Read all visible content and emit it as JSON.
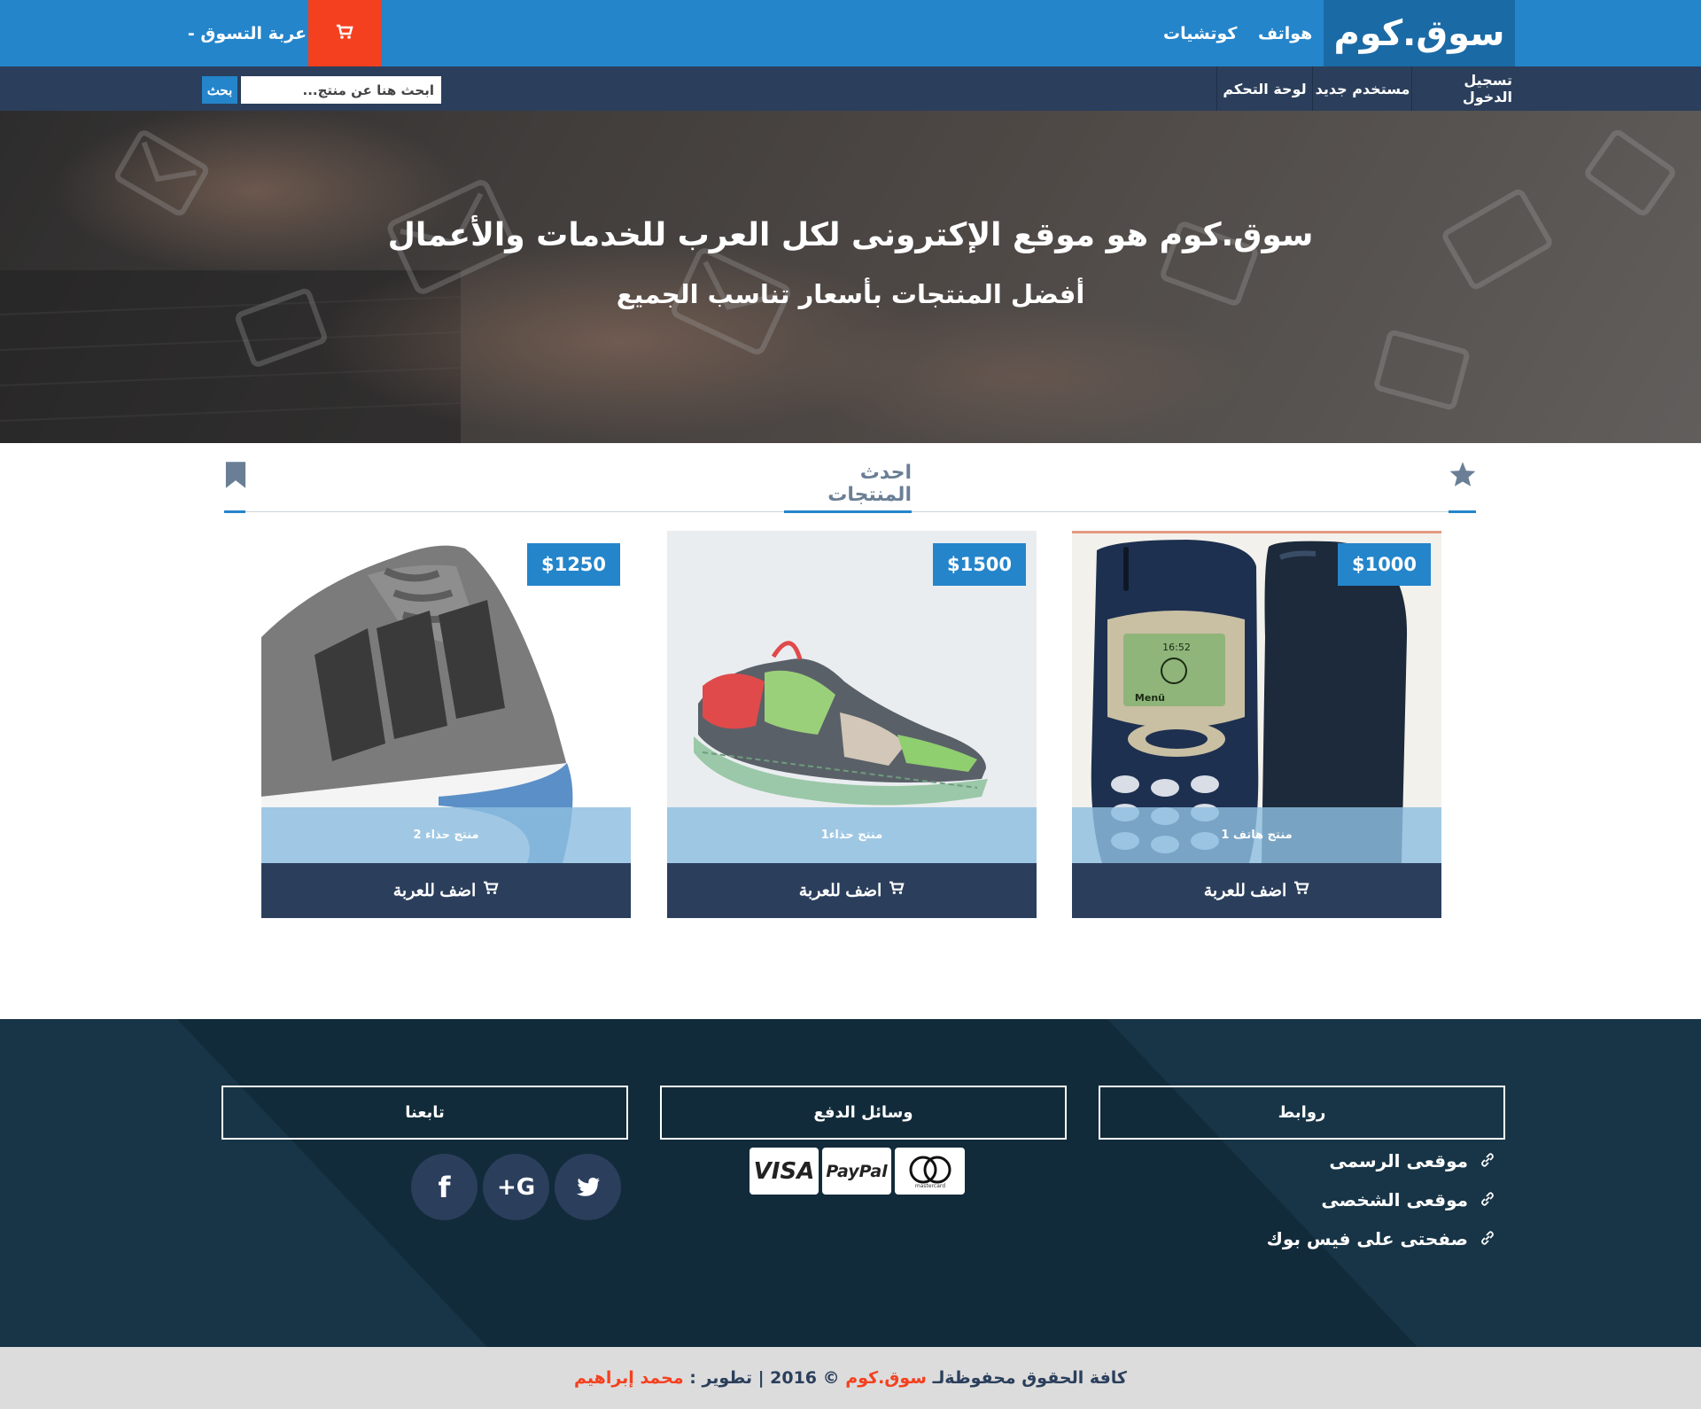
{
  "header": {
    "brand": "سوق.كوم",
    "nav": [
      "هواتف",
      "كوتشيات"
    ],
    "cart_label": "عربة التسوق -"
  },
  "subnav": {
    "links": [
      "تسجيل الدخول",
      "مستخدم جديد",
      "لوحة التحكم"
    ],
    "search_placeholder": "ابحث هنا عن منتج...",
    "search_button": "بحث"
  },
  "hero": {
    "title": "سوق.كوم هو موقع الإكترونى لكل العرب للخدمات والأعمال",
    "subtitle": "أفضل المنتجات بأسعار تناسب الجميع"
  },
  "section": {
    "tab_title": "احدث المنتجات"
  },
  "products": [
    {
      "price": "$1000",
      "name": "منتج هاتف 1",
      "add_label": "اضف للعربة"
    },
    {
      "price": "$1500",
      "name": "منتج حذاء1",
      "add_label": "اضف للعربة"
    },
    {
      "price": "$1250",
      "name": "منتج حذاء 2",
      "add_label": "اضف للعربة"
    }
  ],
  "footer": {
    "links_title": "روابط",
    "payment_title": "وسائل الدفع",
    "follow_title": "تابعنا",
    "links": [
      "موقعى الرسمى",
      "موقعى الشخصى",
      "صفحتى على فيس بوك"
    ],
    "payment_methods": [
      "VISA",
      "PayPal",
      "mastercard"
    ],
    "social": [
      "twitter",
      "google-plus",
      "facebook"
    ]
  },
  "copyright": {
    "prefix": "كافة الحقوق محفوظةلـ",
    "brand": "سوق.كوم",
    "middle": "© 2016 | تطوير :",
    "author": "محمد إبراهيم"
  },
  "colors": {
    "primary": "#2485cb",
    "dark": "#2b3f5c",
    "accent": "#f5401f",
    "footer": "#183547"
  }
}
